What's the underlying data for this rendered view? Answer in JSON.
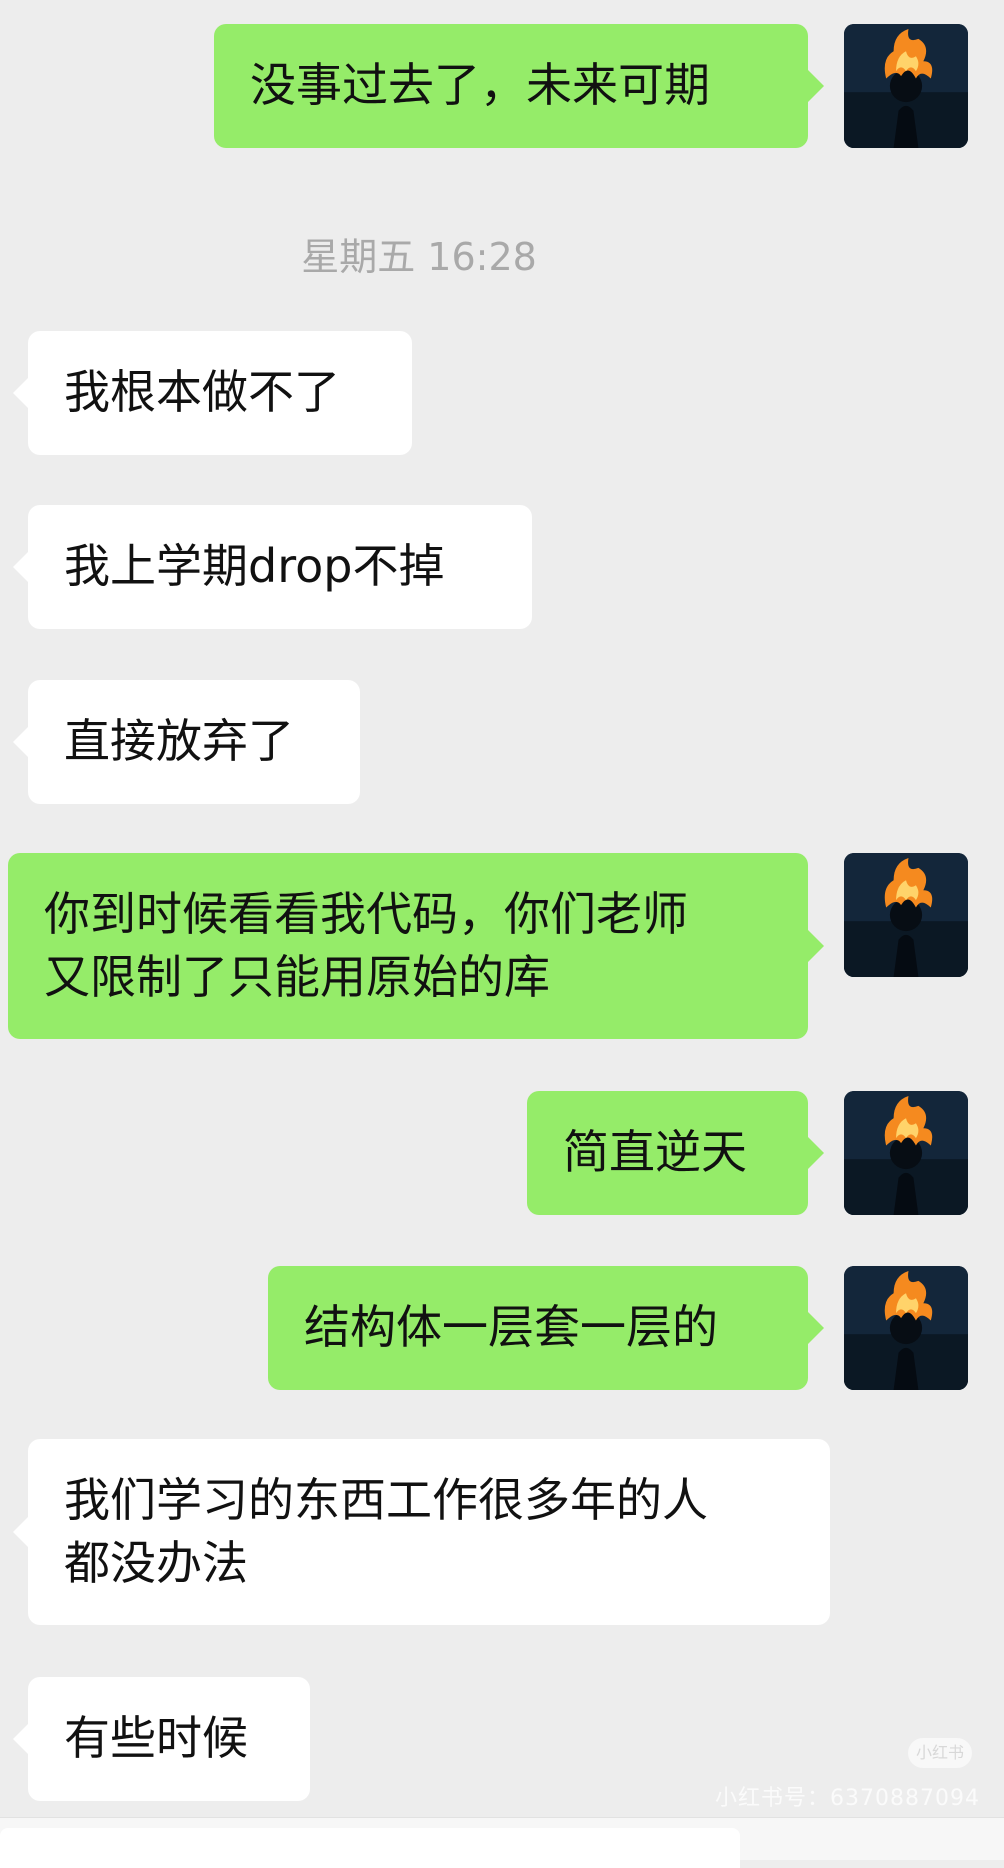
{
  "messages": [
    {
      "from": "me",
      "lines": [
        "没事过去了，未来可期"
      ]
    },
    {
      "from": "them",
      "lines": [
        "我根本做不了"
      ]
    },
    {
      "from": "them",
      "lines": [
        "我上学期drop不掉"
      ]
    },
    {
      "from": "them",
      "lines": [
        "直接放弃了"
      ]
    },
    {
      "from": "me",
      "lines": [
        "你到时候看看我代码，你们老师",
        "又限制了只能用原始的库"
      ]
    },
    {
      "from": "me",
      "lines": [
        "简直逆天"
      ]
    },
    {
      "from": "me",
      "lines": [
        "结构体一层套一层的"
      ]
    },
    {
      "from": "them",
      "lines": [
        "我们学习的东西工作很多年的人",
        "都没办法"
      ]
    },
    {
      "from": "them",
      "lines": [
        "有些时候"
      ]
    }
  ],
  "timestamp": "星期五 16:28",
  "watermark": {
    "badge": "小红书",
    "text": "小红书号：6370887094"
  },
  "colors": {
    "outgoing_bubble": "#95ec69",
    "incoming_bubble": "#ffffff",
    "background": "#ededed",
    "timestamp_text": "#a9a9a9"
  },
  "icons": {
    "avatar": "flaming-head-avatar-icon"
  }
}
